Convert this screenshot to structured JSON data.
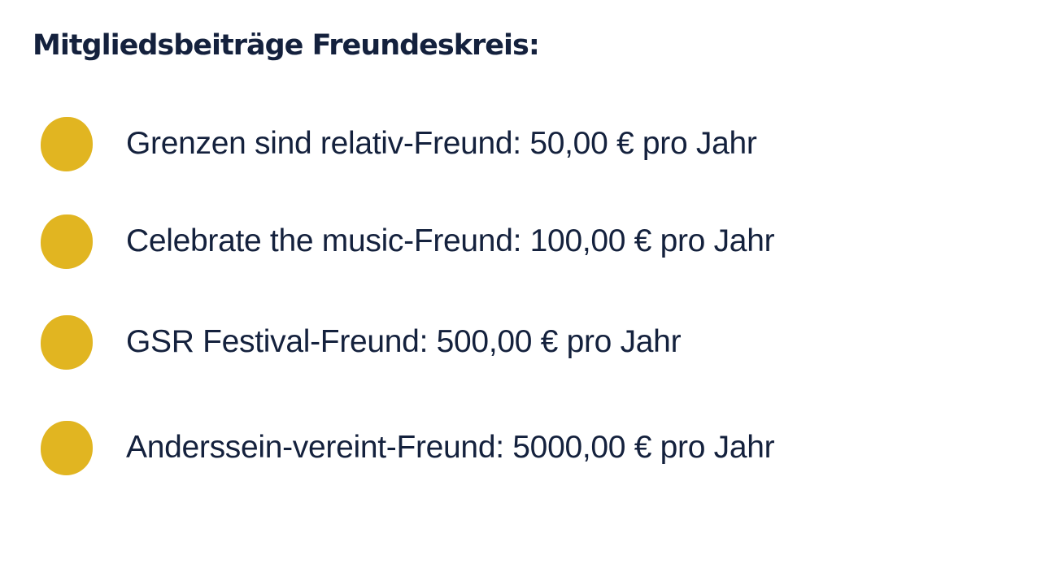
{
  "slide": {
    "title": "Mitgliedsbeiträge Freundeskreis:",
    "bullet_color": "#e1b521",
    "text_color": "#14213d",
    "items": [
      {
        "text": "Grenzen sind relativ-Freund: 50,00 € pro Jahr"
      },
      {
        "text": "Celebrate the music-Freund: 100,00 € pro Jahr"
      },
      {
        "text": "GSR Festival-Freund: 500,00 € pro Jahr"
      },
      {
        "text": "Anderssein-vereint-Freund: 5000,00 € pro Jahr"
      }
    ]
  }
}
